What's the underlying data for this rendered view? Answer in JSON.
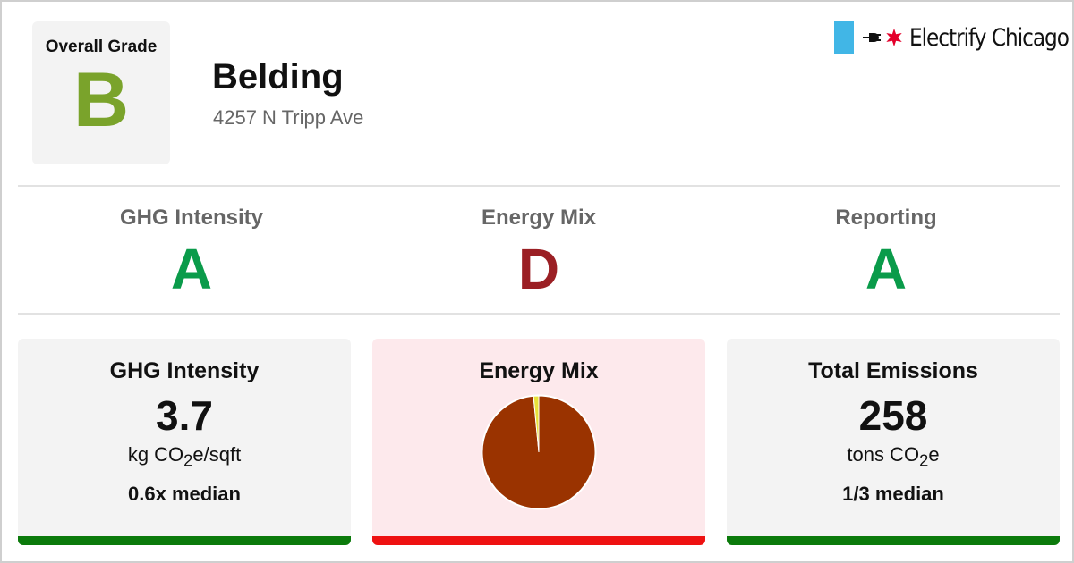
{
  "overall": {
    "label": "Overall Grade",
    "grade": "B",
    "grade_color": "#7aa32b"
  },
  "building": {
    "name": "Belding",
    "address": "4257 N Tripp Ave"
  },
  "brand": {
    "name": "Electrify Chicago",
    "stripe_color": "#41b6e6",
    "star_color": "#e4002b",
    "icons": [
      "plug-icon",
      "star-icon"
    ]
  },
  "subgrades": [
    {
      "label": "GHG Intensity",
      "grade": "A",
      "color": "#0a9b4a"
    },
    {
      "label": "Energy Mix",
      "grade": "D",
      "color": "#9b1f24"
    },
    {
      "label": "Reporting",
      "grade": "A",
      "color": "#0a9b4a"
    }
  ],
  "cards": {
    "ghg": {
      "title": "GHG Intensity",
      "value": "3.7",
      "unit_prefix": "kg CO",
      "unit_sub": "2",
      "unit_suffix": "e/sqft",
      "median": "0.6x median",
      "background": "#f3f3f3",
      "bar_color": "#0b7a0b"
    },
    "energy_mix": {
      "title": "Energy Mix",
      "background": "#fde9ec",
      "bar_color": "#ee1111",
      "slice_colors": [
        "#9a3300",
        "#e8e23a"
      ],
      "slice_fractions": [
        0.985,
        0.015
      ]
    },
    "emissions": {
      "title": "Total Emissions",
      "value": "258",
      "unit_prefix": "tons CO",
      "unit_sub": "2",
      "unit_suffix": "e",
      "median": "1/3 median",
      "background": "#f3f3f3",
      "bar_color": "#0b7a0b"
    }
  }
}
